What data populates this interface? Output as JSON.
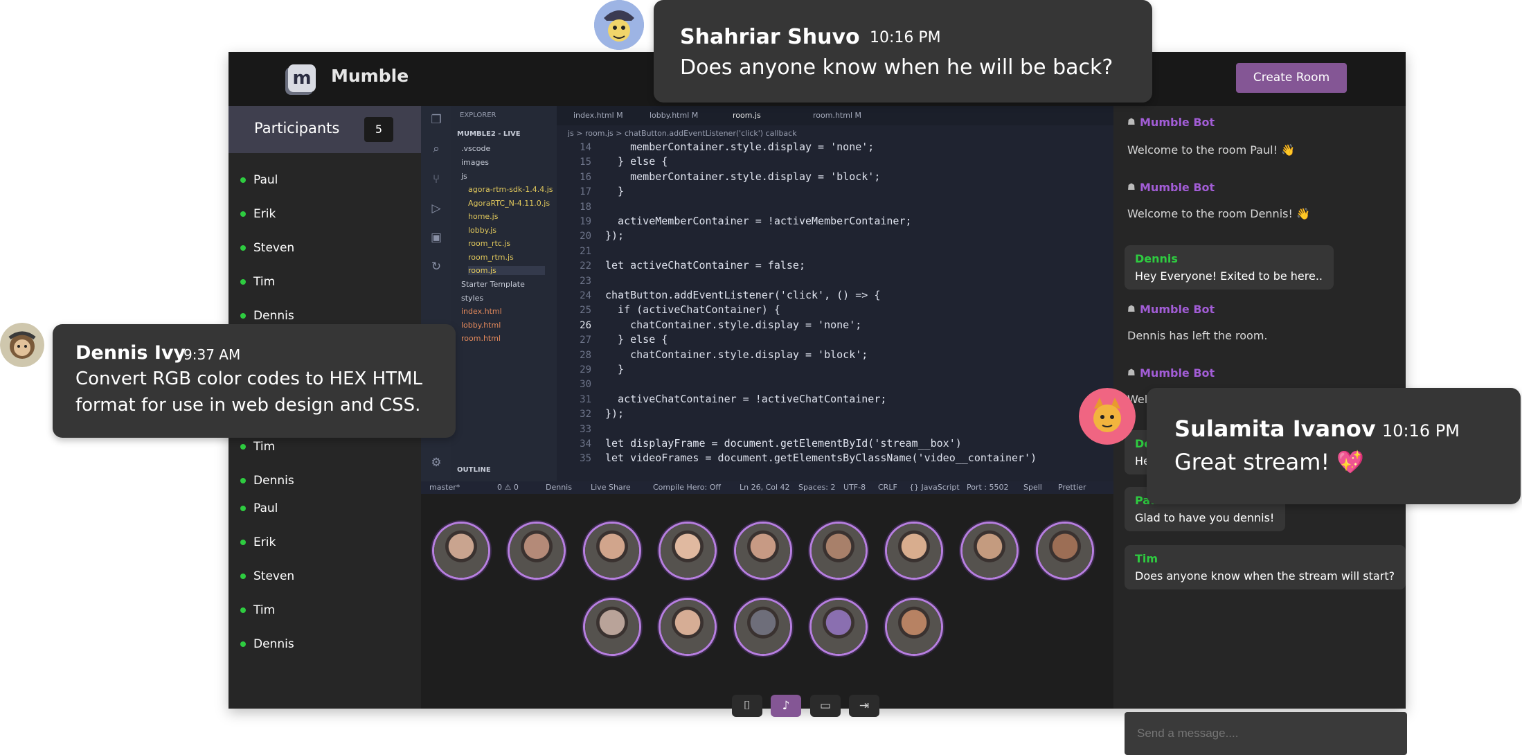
{
  "app": {
    "brand": "Mumble",
    "create_room": "Create Room"
  },
  "participants": {
    "title": "Participants",
    "count": "5",
    "names": [
      "Paul",
      "Erik",
      "Steven",
      "Tim",
      "Dennis",
      "Tim",
      "Dennis",
      "Paul",
      "Erik",
      "Steven",
      "Tim",
      "Dennis"
    ]
  },
  "editor": {
    "explorer_title": "EXPLORER",
    "project": "MUMBLE2 - LIVE",
    "tree": [
      ".vscode",
      "images",
      "js",
      "agora-rtm-sdk-1.4.4.js",
      "AgoraRTC_N-4.11.0.js",
      "home.js",
      "lobby.js",
      "room_rtc.js",
      "room_rtm.js",
      "room.js",
      "Starter Template",
      "styles",
      "index.html",
      "lobby.html",
      "room.html"
    ],
    "outline": "OUTLINE",
    "tabs": [
      "index.html M",
      "lobby.html M",
      "room.js",
      "room.html M"
    ],
    "breadcrumb": "js > room.js > chatButton.addEventListener('click') callback",
    "line_numbers": [
      "14",
      "15",
      "16",
      "17",
      "18",
      "19",
      "20",
      "21",
      "22",
      "23",
      "24",
      "25",
      "26",
      "27",
      "28",
      "29",
      "30",
      "31",
      "32",
      "33",
      "34",
      "35"
    ],
    "code_lines": [
      "    memberContainer.style.display = 'none';",
      "  } else {",
      "    memberContainer.style.display = 'block';",
      "  }",
      "",
      "  activeMemberContainer = !activeMemberContainer;",
      "});",
      "",
      "let activeChatContainer = false;",
      "",
      "chatButton.addEventListener('click', () => {",
      "  if (activeChatContainer) {",
      "    chatContainer.style.display = 'none';",
      "  } else {",
      "    chatContainer.style.display = 'block';",
      "  }",
      "",
      "  activeChatContainer = !activeChatContainer;",
      "});",
      "",
      "let displayFrame = document.getElementById('stream__box')",
      "let videoFrames = document.getElementsByClassName('video__container')"
    ],
    "status": [
      "master*",
      "0 ⚠ 0",
      "Dennis",
      "Live Share",
      "Compile Hero: Off",
      "Ln 26, Col 42",
      "Spaces: 2",
      "UTF-8",
      "CRLF",
      "{} JavaScript",
      "Port : 5502",
      "Spell",
      "Prettier"
    ]
  },
  "avatar_colors": [
    "#c9a48f",
    "#b48a78",
    "#d1a58c",
    "#e0b9a0",
    "#c79a84",
    "#a8806a",
    "#d8ad8e",
    "#c49b7f",
    "#9c6e55",
    "#b9a399",
    "#d6ad95",
    "#6e6e7a",
    "#8a6fb0",
    "#b78263"
  ],
  "chat": {
    "messages": [
      {
        "bot": true,
        "name": "Mumble Bot",
        "text": "Welcome to the room Paul! 👋"
      },
      {
        "bot": true,
        "name": "Mumble Bot",
        "text": "Welcome to the room Dennis! 👋"
      },
      {
        "bot": false,
        "name": "Dennis",
        "text": "Hey Everyone! Exited to be here.."
      },
      {
        "bot": true,
        "name": "Mumble Bot",
        "text": "Dennis has left the room."
      },
      {
        "bot": true,
        "name": "Mumble Bot",
        "text": "Welc"
      },
      {
        "bot": false,
        "name": "Denn",
        "text": "Hey"
      },
      {
        "bot": false,
        "name": "Paul",
        "text": "Glad to have you dennis!"
      },
      {
        "bot": false,
        "name": "Tim",
        "text": "Does anyone know when the stream will start?"
      }
    ],
    "placeholder": "Send a message...."
  },
  "bubbles": {
    "top": {
      "name": "Shahriar Shuvo",
      "time": "10:16 PM",
      "text": "Does anyone know when he will be back?"
    },
    "left": {
      "name": "Dennis Ivy",
      "time": "9:37 AM",
      "text1": "Convert RGB color codes to HEX HTML",
      "text2": "format for use in web design and CSS."
    },
    "right": {
      "name": "Sulamita Ivanov",
      "time": "10:16 PM",
      "text": "Great stream! 💖"
    }
  }
}
